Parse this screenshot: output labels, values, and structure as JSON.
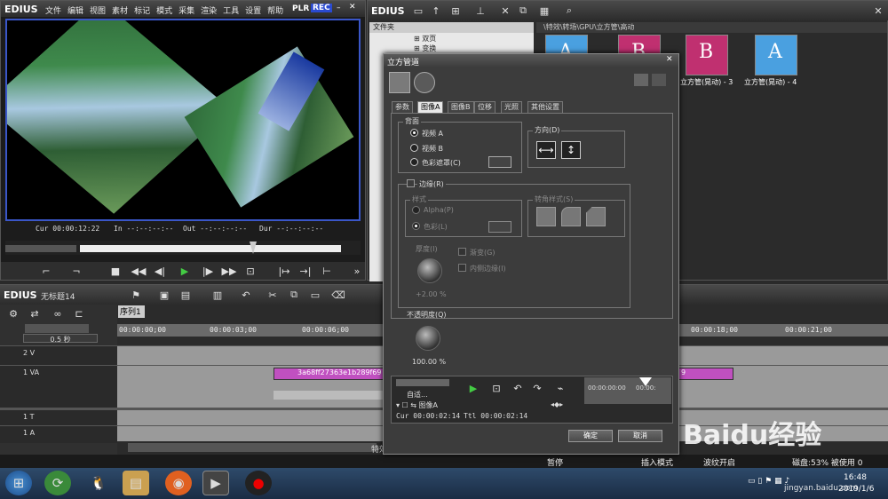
{
  "player": {
    "app_name": "EDIUS",
    "menu": [
      "文件",
      "编辑",
      "视图",
      "素材",
      "标记",
      "模式",
      "采集",
      "渲染",
      "工具",
      "设置",
      "帮助"
    ],
    "plr": "PLR",
    "rec": "REC",
    "cur": "Cur 00:00:12:22",
    "in": "In --:--:--:--",
    "out": "Out --:--:--:--",
    "dur": "Dur --:--:--:--"
  },
  "bin": {
    "app_name": "EDIUS",
    "folder_header": "文件夹",
    "tree": [
      "双页",
      "变换"
    ],
    "path": "\\特效\\转场\\GPU\\立方管\\高动",
    "thumbs": [
      {
        "label": "立方管(晃动) - 3",
        "letter": "B",
        "bg": "#c03070"
      },
      {
        "label": "立方管(晃动) - 4",
        "letter": "A",
        "bg": "#4aa0e0"
      }
    ],
    "thumb_letters": [
      "A",
      "B"
    ]
  },
  "timeline": {
    "app_name": "EDIUS",
    "project": "无标题14",
    "sequence_tab": "序列1",
    "zoom": "0.5 秒",
    "ticks": [
      "00:00:00;00",
      "00:00:03;00",
      "00:00:06;00",
      "00:00:18;00",
      "00:00:21;00"
    ],
    "tracks": [
      "2 V",
      "1 VA",
      "1 T",
      "1 A"
    ],
    "clip_label": "3a68ff27363e1b289f69",
    "clip_tail": "9",
    "panel_label": "特效"
  },
  "status": {
    "pause": "暂停",
    "insert_mode": "插入模式",
    "ripple": "波纹开启",
    "disk": "磁盘:53% 被使用 0"
  },
  "taskbar": {
    "time": "16:48",
    "date": "2019/1/6"
  },
  "dialog": {
    "title": "立方管道",
    "tabs": [
      "参数",
      "图像A",
      "图像B",
      "位移",
      "光照",
      "其他设置"
    ],
    "background_group": "背面",
    "opt_video_a": "视频 A",
    "opt_video_b": "视频 B",
    "opt_color_matte": "色彩遮罩(C)",
    "direction_group": "方向(D)",
    "border_check": "边缘(R)",
    "style_group": "样式",
    "opt_alpha": "Alpha(P)",
    "opt_color": "色彩(L)",
    "bevel_group": "转角样式(S)",
    "thickness_label": "厚度(I)",
    "thickness_value": "+2.00 %",
    "gradient_check": "渐变(G)",
    "inner_edge_check": "内侧边缘(I)",
    "opacity_label": "不透明度(Q)",
    "opacity_value": "100.00 %",
    "auto_label": "自适...",
    "mini_ticks": [
      "00:00:00:00",
      "00:00:"
    ],
    "image_a": "图像A",
    "cur_time": "Cur 00:00:02:14",
    "ttl_time": "Ttl 00:00:02:14",
    "ok": "确定",
    "cancel": "取消"
  },
  "watermark": {
    "brand": "Baidu经验",
    "url": "jingyan.baidu.com"
  }
}
